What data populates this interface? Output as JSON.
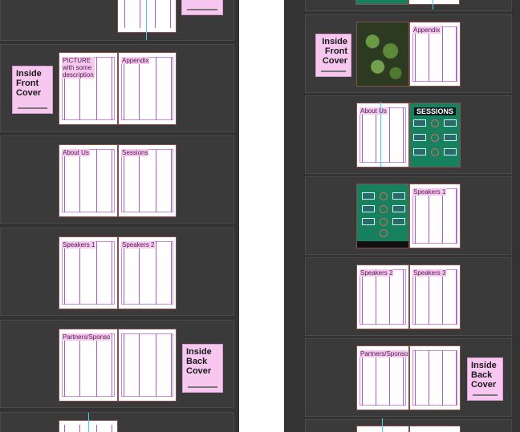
{
  "left_panel": {
    "labels": {
      "picture": "PICTURE\nwith some\ndescription",
      "appendix": "Appendix",
      "about_us": "About Us",
      "sessions": "Sessions",
      "speakers_1": "Speakers 1",
      "speakers_2": "Speakers 2",
      "partners": "Partners/Sponsors"
    },
    "notes": {
      "inside_front_cover": "Inside\nFront\nCover",
      "inside_back_cover": "Inside\nBack\nCover"
    }
  },
  "right_panel": {
    "labels": {
      "appendix": "Appendix",
      "about_us": "About Us",
      "sessions_heading": "SESSIONS",
      "speakers_1": "Speakers 1",
      "speakers_2": "Speakers 2",
      "speakers_3": "Speakers 3",
      "partners": "Partners/Sponsors"
    },
    "notes": {
      "inside_front_cover": "Inside\nFront\nCover",
      "inside_back_cover": "Inside\nBack\nCover"
    }
  },
  "colors": {
    "panel_bg": "#333333",
    "note_pink": "#f7c7ef",
    "column_guide": "#b257d8",
    "spread_guide": "#40d0f0",
    "dark_page": "#17805f"
  }
}
